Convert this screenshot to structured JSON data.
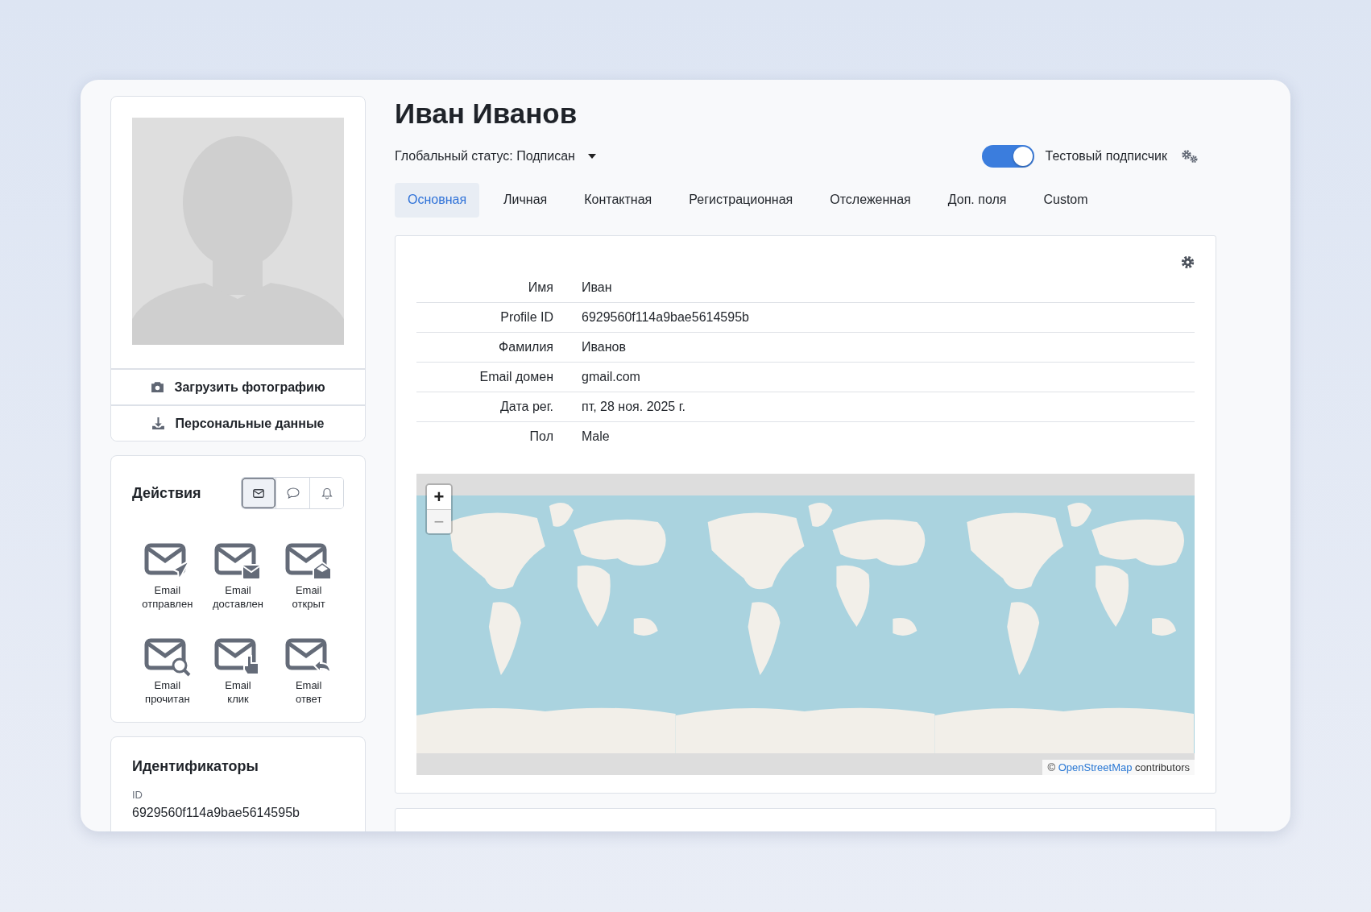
{
  "profile": {
    "name": "Иван Иванов",
    "status_label": "Глобальный статус:",
    "status_value": "Подписан",
    "test_subscriber": {
      "label": "Тестовый подписчик",
      "on": true
    }
  },
  "photo_actions": [
    {
      "kind": "camera",
      "label": "Загрузить фотографию"
    },
    {
      "kind": "download",
      "label": "Персональные данные"
    }
  ],
  "actions": {
    "title": "Действия",
    "filters": [
      {
        "kind": "email",
        "selected": true
      },
      {
        "kind": "chat",
        "selected": false
      },
      {
        "kind": "bell",
        "selected": false
      }
    ],
    "items": [
      {
        "kind": "sent",
        "label": "Email\nотправлен"
      },
      {
        "kind": "delivered",
        "label": "Email\nдоставлен"
      },
      {
        "kind": "opened",
        "label": "Email\nоткрыт"
      },
      {
        "kind": "read",
        "label": "Email\nпрочитан"
      },
      {
        "kind": "click",
        "label": "Email\nклик"
      },
      {
        "kind": "reply",
        "label": "Email\nответ"
      }
    ]
  },
  "identifiers": {
    "title": "Идентификаторы",
    "fields": [
      {
        "label": "ID",
        "value": "6929560f114a9bae5614595b"
      }
    ]
  },
  "tabs": [
    {
      "label": "Основная",
      "selected": true
    },
    {
      "label": "Личная",
      "selected": false
    },
    {
      "label": "Контактная",
      "selected": false
    },
    {
      "label": "Регистрационная",
      "selected": false
    },
    {
      "label": "Отслеженная",
      "selected": false
    },
    {
      "label": "Доп. поля",
      "selected": false
    },
    {
      "label": "Custom",
      "selected": false
    }
  ],
  "details": [
    {
      "label": "Имя",
      "value": "Иван"
    },
    {
      "label": "Profile ID",
      "value": "6929560f114a9bae5614595b"
    },
    {
      "label": "Фамилия",
      "value": "Иванов"
    },
    {
      "label": "Email домен",
      "value": "gmail.com"
    },
    {
      "label": "Дата рег.",
      "value": "пт, 28 ноя. 2025 г."
    },
    {
      "label": "Пол",
      "value": "Male"
    }
  ],
  "map": {
    "zoom_buttons": [
      {
        "label": "+",
        "disabled": false
      },
      {
        "label": "−",
        "disabled": true
      }
    ],
    "attribution": {
      "before": "©",
      "link": "OpenStreetMap",
      "after": "contributors"
    }
  }
}
